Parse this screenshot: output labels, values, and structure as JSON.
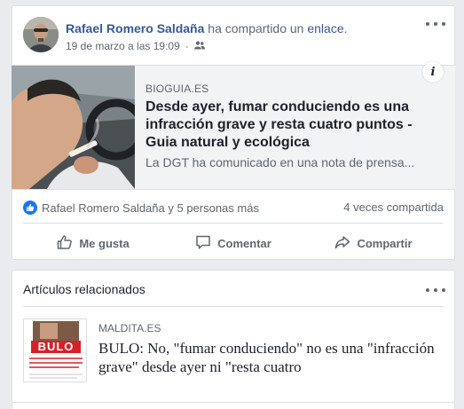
{
  "post": {
    "author": "Rafael Romero Saldaña",
    "verb": "ha compartido un",
    "link_word": "enlace",
    "link_suffix": ".",
    "timestamp": "19 de marzo a las 19:09",
    "timestamp_separator": "·",
    "audience_icon": "friends-icon",
    "link_preview": {
      "domain": "BIOGUIA.ES",
      "title": "Desde ayer, fumar conduciendo es una infracción grave y resta cuatro puntos - Guia natural y ecológica",
      "description": "La DGT ha comunicado en una nota de prensa...",
      "info_icon_label": "i"
    },
    "reactions": {
      "summary": "Rafael Romero Saldaña y 5 personas más",
      "shares": "4 veces compartida"
    },
    "actions": {
      "like": "Me gusta",
      "comment": "Comentar",
      "share": "Compartir"
    }
  },
  "related": {
    "heading": "Artículos relacionados",
    "item": {
      "thumb_label": "BULO",
      "domain": "MALDITA.ES",
      "title": "BULO: No, \"fumar conduciendo\" no es una \"infracción grave\" desde ayer ni \"resta cuatro"
    }
  },
  "colors": {
    "link_blue": "#385898",
    "like_blue": "#1877f2",
    "bulo_red": "#d3222a"
  }
}
